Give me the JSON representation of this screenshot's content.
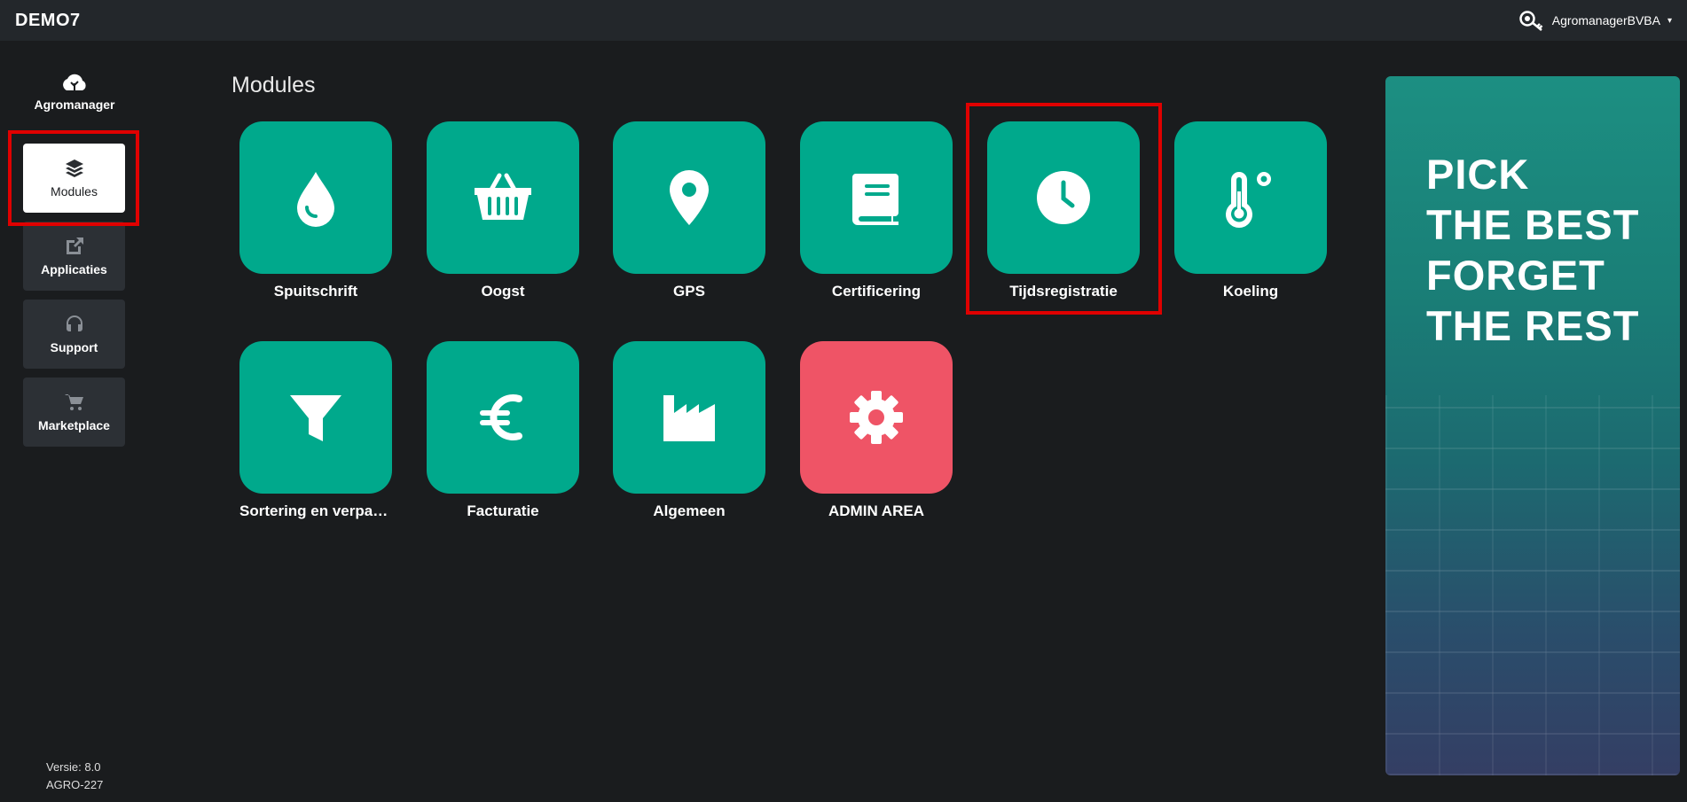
{
  "topbar": {
    "brand": "DEMO7",
    "user_name": "AgromanagerBVBA",
    "caret": "▾"
  },
  "sidebar": {
    "logo_text": "Agromanager",
    "items": [
      {
        "label": "Modules",
        "icon": "layers-icon",
        "active": true
      },
      {
        "label": "Applicaties",
        "icon": "external-link-icon",
        "active": false
      },
      {
        "label": "Support",
        "icon": "headset-icon",
        "active": false
      },
      {
        "label": "Marketplace",
        "icon": "cart-icon",
        "active": false
      }
    ],
    "version_line1": "Versie: 8.0",
    "version_line2": "AGRO-227"
  },
  "main": {
    "title": "Modules",
    "modules": [
      {
        "label": "Spuitschrift",
        "icon": "droplet-icon"
      },
      {
        "label": "Oogst",
        "icon": "basket-icon"
      },
      {
        "label": "GPS",
        "icon": "map-pin-icon"
      },
      {
        "label": "Certificering",
        "icon": "book-icon"
      },
      {
        "label": "Tijdsregistratie",
        "icon": "clock-icon"
      },
      {
        "label": "Koeling",
        "icon": "thermometer-icon"
      },
      {
        "label": "Sortering en verpakking",
        "icon": "funnel-icon"
      },
      {
        "label": "Facturatie",
        "icon": "euro-icon"
      },
      {
        "label": "Algemeen",
        "icon": "factory-icon"
      },
      {
        "label": "ADMIN AREA",
        "icon": "gear-icon"
      }
    ]
  },
  "banner": {
    "line1": "PICK",
    "line2": "THE BEST",
    "line3": "FORGET",
    "line4": "THE REST"
  },
  "colors": {
    "tile": "#00a98c",
    "admin_tile": "#ef5466",
    "highlight": "#e00000",
    "background": "#1a1c1e",
    "topbar": "#23272b"
  }
}
